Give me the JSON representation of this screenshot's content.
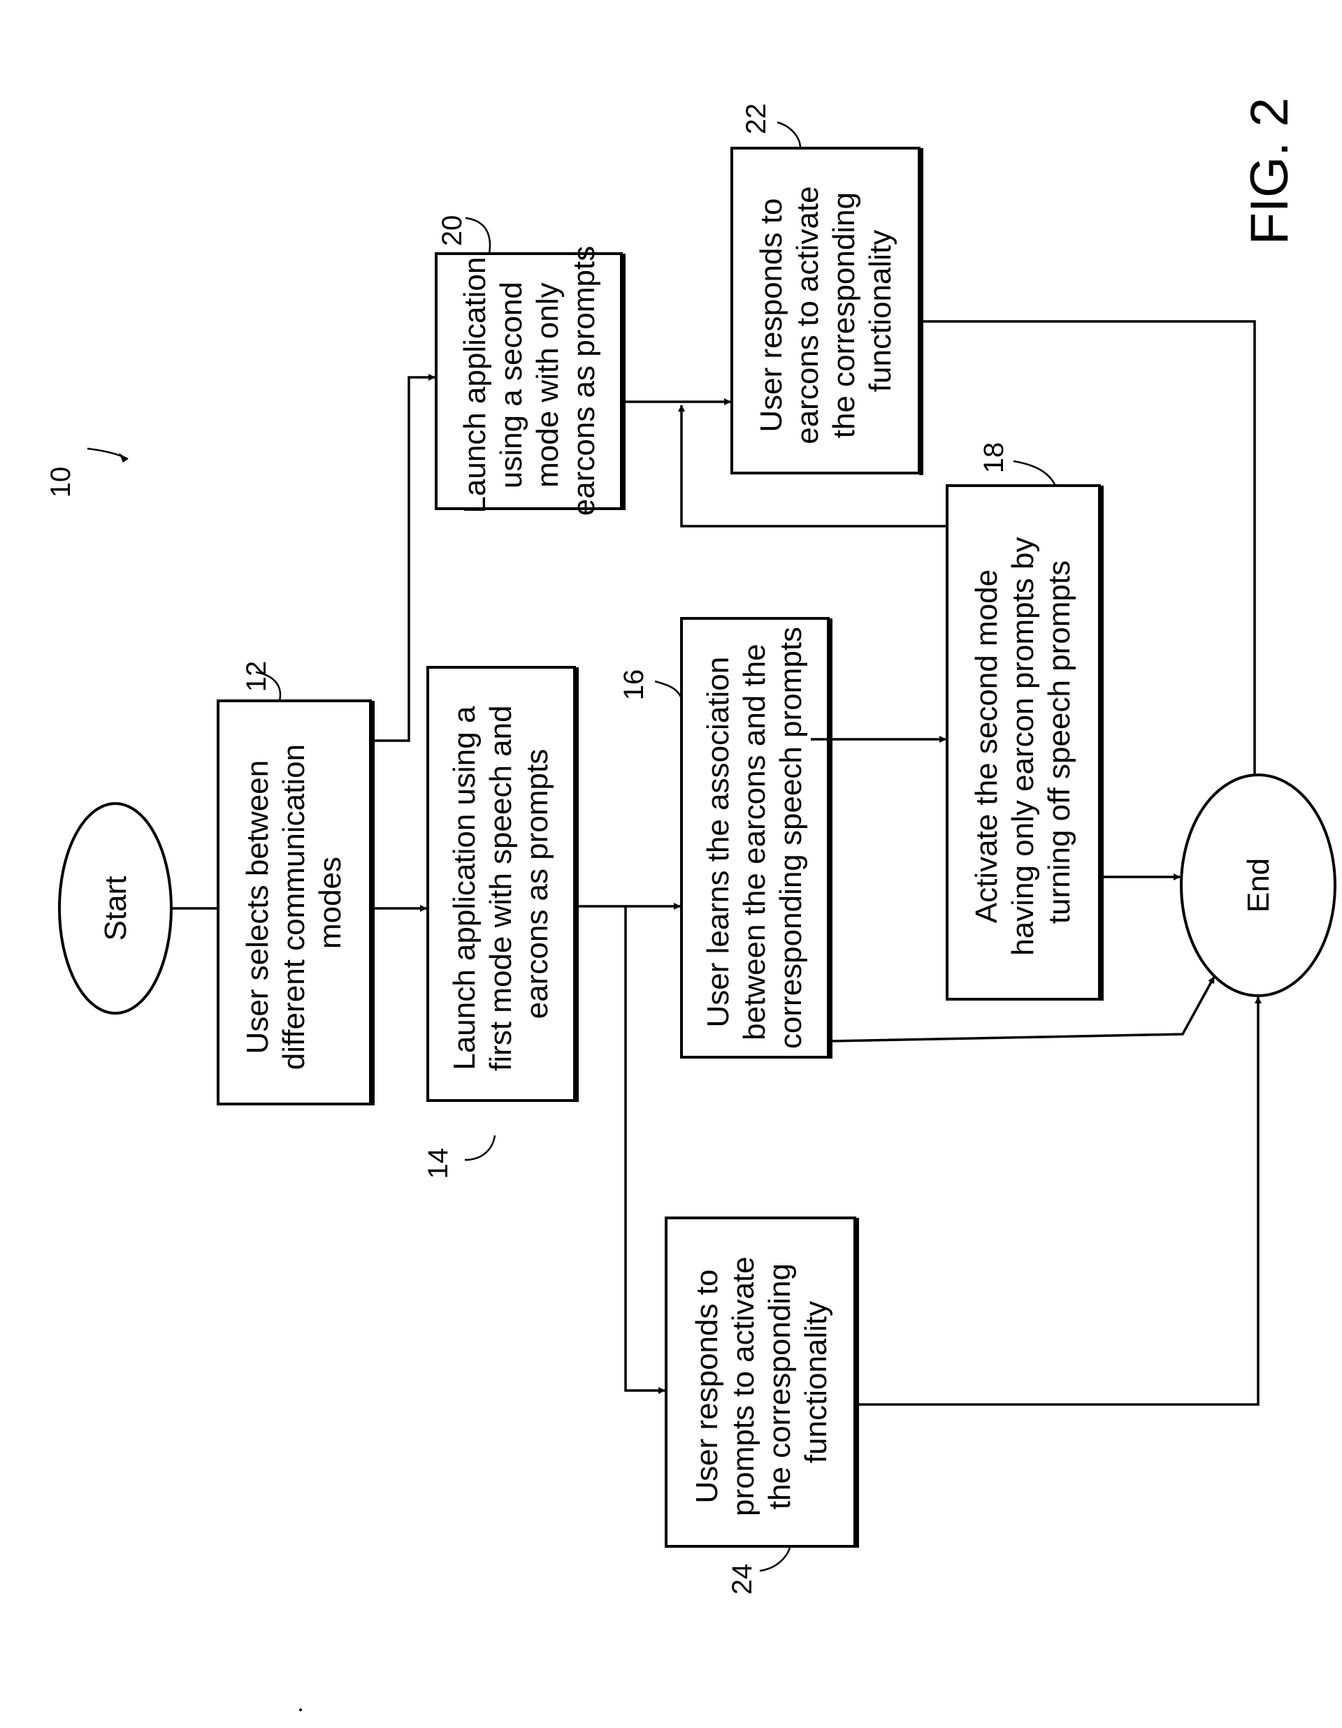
{
  "figure": {
    "title": "FIG. 2",
    "reference": "10",
    "orientation": "rotated-90-ccw"
  },
  "nodes": {
    "start": {
      "label": "Start"
    },
    "end": {
      "label": "End"
    },
    "step12": {
      "ref": "12",
      "lines": [
        "User selects between",
        "different communication",
        "modes"
      ]
    },
    "step14": {
      "ref": "14",
      "lines": [
        "Launch application using a",
        "first mode with speech and",
        "earcons as prompts"
      ]
    },
    "step16": {
      "ref": "16",
      "lines": [
        "User learns the association",
        "between the earcons and the",
        "corresponding speech prompts"
      ]
    },
    "step18": {
      "ref": "18",
      "lines": [
        "Activate the second mode",
        "having only earcon prompts by",
        "turning off speech prompts"
      ]
    },
    "step20": {
      "ref": "20",
      "lines": [
        "Launch application",
        "using a second",
        "mode with only",
        "earcons as prompts"
      ]
    },
    "step22": {
      "ref": "22",
      "lines": [
        "User responds to",
        "earcons to activate",
        "the corresponding",
        "functionality"
      ]
    },
    "step24": {
      "ref": "24",
      "lines": [
        "User responds to",
        "prompts to activate",
        "the corresponding",
        "functionality"
      ]
    }
  },
  "edges": [
    {
      "from": "start",
      "to": "step12"
    },
    {
      "from": "step12",
      "to": "step14"
    },
    {
      "from": "step12",
      "to": "step20"
    },
    {
      "from": "step14",
      "to": "step16"
    },
    {
      "from": "step14",
      "to": "step24"
    },
    {
      "from": "step16",
      "to": "step18"
    },
    {
      "from": "step16",
      "to": "end"
    },
    {
      "from": "step18",
      "to": "step22"
    },
    {
      "from": "step18",
      "to": "end"
    },
    {
      "from": "step20",
      "to": "step22"
    },
    {
      "from": "step22",
      "to": "end"
    },
    {
      "from": "step24",
      "to": "end"
    }
  ]
}
